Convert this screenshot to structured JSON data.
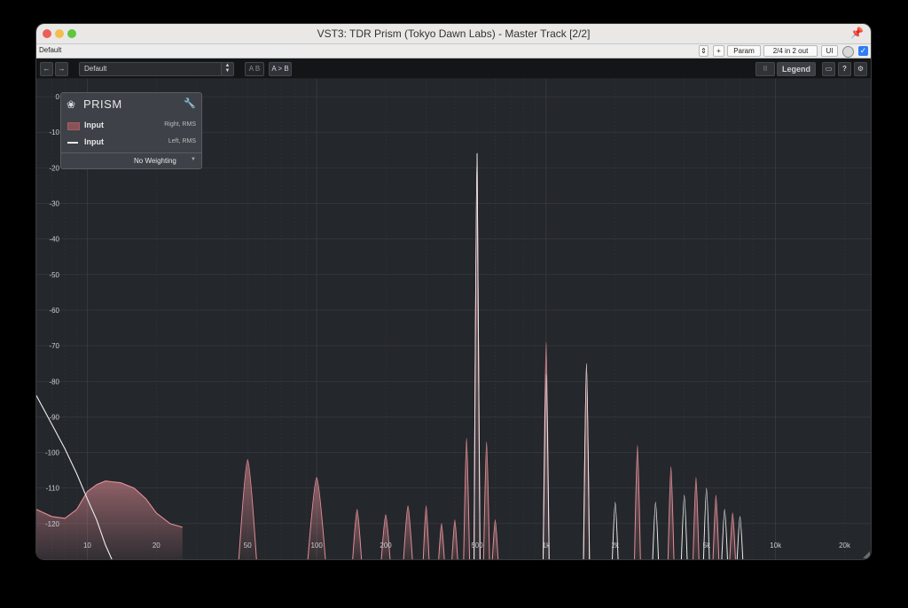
{
  "window": {
    "title": "VST3: TDR Prism (Tokyo Dawn Labs) - Master Track [2/2]",
    "pin_icon": "pin-icon"
  },
  "host_bar": {
    "preset": "Default",
    "plus": "+",
    "param": "Param",
    "io": "2/4 in 2 out",
    "ui": "UI"
  },
  "plugin_bar": {
    "back_icon": "←",
    "forward_icon": "→",
    "preset": "Default",
    "ab": "A B",
    "a_to_b": "A > B",
    "pause_icon": "II",
    "legend": "Legend",
    "display_icon": "▭",
    "help": "?",
    "settings_icon": "⚙"
  },
  "legend": {
    "title": "PRISM",
    "rows": [
      {
        "name": "Input",
        "desc": "Right, RMS",
        "color": "#8a5257"
      },
      {
        "name": "Input",
        "desc": "Left, RMS",
        "color": "#eaeaea"
      }
    ],
    "weighting": "No Weighting"
  },
  "colors": {
    "right_channel": "#e58f98",
    "left_channel": "#eeeeee",
    "background": "#24272b",
    "grid": "#3a3d42"
  },
  "chart_data": {
    "type": "line",
    "x_scale": "log",
    "xlim": [
      6,
      26000
    ],
    "ylim": [
      -130,
      5
    ],
    "grid": true,
    "y_ticks": [
      0,
      -10,
      -20,
      -30,
      -40,
      -50,
      -60,
      -70,
      -80,
      -90,
      -100,
      -110,
      -120
    ],
    "x_ticks": [
      {
        "v": 10,
        "l": "10"
      },
      {
        "v": 20,
        "l": "20"
      },
      {
        "v": 50,
        "l": "50"
      },
      {
        "v": 100,
        "l": "100"
      },
      {
        "v": 200,
        "l": "200"
      },
      {
        "v": 500,
        "l": "500"
      },
      {
        "v": 1000,
        "l": "1k"
      },
      {
        "v": 2000,
        "l": "2k"
      },
      {
        "v": 5000,
        "l": "5k"
      },
      {
        "v": 10000,
        "l": "10k"
      },
      {
        "v": 20000,
        "l": "20k"
      }
    ],
    "series": [
      {
        "name": "Input",
        "channel": "Right, RMS",
        "smooth": [
          [
            6,
            -116
          ],
          [
            7,
            -118
          ],
          [
            8,
            -118.5
          ],
          [
            9,
            -116
          ],
          [
            10,
            -111
          ],
          [
            11,
            -109
          ],
          [
            12,
            -108
          ],
          [
            14,
            -108.5
          ],
          [
            16,
            -110
          ],
          [
            18,
            -113
          ],
          [
            20,
            -117
          ],
          [
            23,
            -120
          ],
          [
            26,
            -121
          ]
        ],
        "peaks": [
          [
            50,
            -102
          ],
          [
            100,
            -107
          ],
          [
            150,
            -116
          ],
          [
            200,
            -117.5
          ],
          [
            250,
            -115
          ],
          [
            300,
            -115
          ],
          [
            350,
            -120
          ],
          [
            400,
            -119
          ],
          [
            450,
            -96
          ],
          [
            500,
            -16
          ],
          [
            550,
            -97
          ],
          [
            600,
            -119
          ],
          [
            1000,
            -69
          ],
          [
            1500,
            -75
          ],
          [
            2500,
            -98
          ],
          [
            3500,
            -104
          ],
          [
            4500,
            -107
          ],
          [
            5500,
            -112
          ],
          [
            6500,
            -117
          ]
        ]
      },
      {
        "name": "Input",
        "channel": "Left, RMS",
        "smooth": [
          [
            6,
            -84
          ],
          [
            7,
            -92
          ],
          [
            8,
            -99
          ],
          [
            9,
            -106
          ],
          [
            10,
            -113
          ],
          [
            11,
            -119
          ],
          [
            12,
            -126
          ],
          [
            13,
            -131
          ]
        ],
        "peaks": [
          [
            500,
            -16
          ],
          [
            1000,
            -78
          ],
          [
            1500,
            -75
          ],
          [
            2000,
            -114
          ],
          [
            3000,
            -114
          ],
          [
            4000,
            -112
          ],
          [
            5000,
            -110
          ],
          [
            6000,
            -116
          ],
          [
            7000,
            -118
          ]
        ]
      }
    ]
  }
}
